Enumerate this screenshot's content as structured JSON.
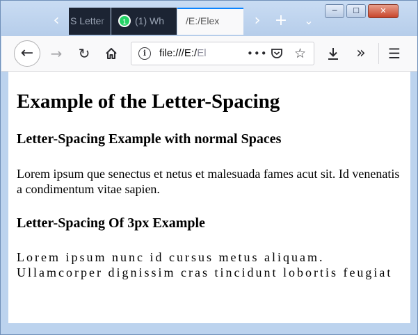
{
  "browser": {
    "tabs": [
      {
        "label": "S Letter",
        "active": false
      },
      {
        "label": "(1) Wh",
        "badge": "1",
        "active": false
      },
      {
        "label": "/E:/Elex",
        "active": true
      }
    ],
    "url": {
      "visible": "file:///E:/",
      "dim": "El"
    },
    "window_controls": {
      "minimize": "─",
      "maximize": "☐",
      "close": "✕"
    }
  },
  "page": {
    "title": "Example of the Letter-Spacing",
    "section1_heading": "Letter-Spacing Example with normal Spaces",
    "section1_text": "Lorem ipsum que senectus et netus et malesuada fames acut sit. Id venenatis a condimentum vitae sapien.",
    "section2_heading": "Letter-Spacing Of 3px Example",
    "section2_text": "Lorem ipsum nunc id cursus metus aliquam. Ullamcorper dignissim cras tincidunt lobortis feugiat"
  },
  "colors": {
    "tab_dark": "#1c2433",
    "tab_active_accent": "#0a84ff",
    "frame": "#bcd3ee"
  }
}
